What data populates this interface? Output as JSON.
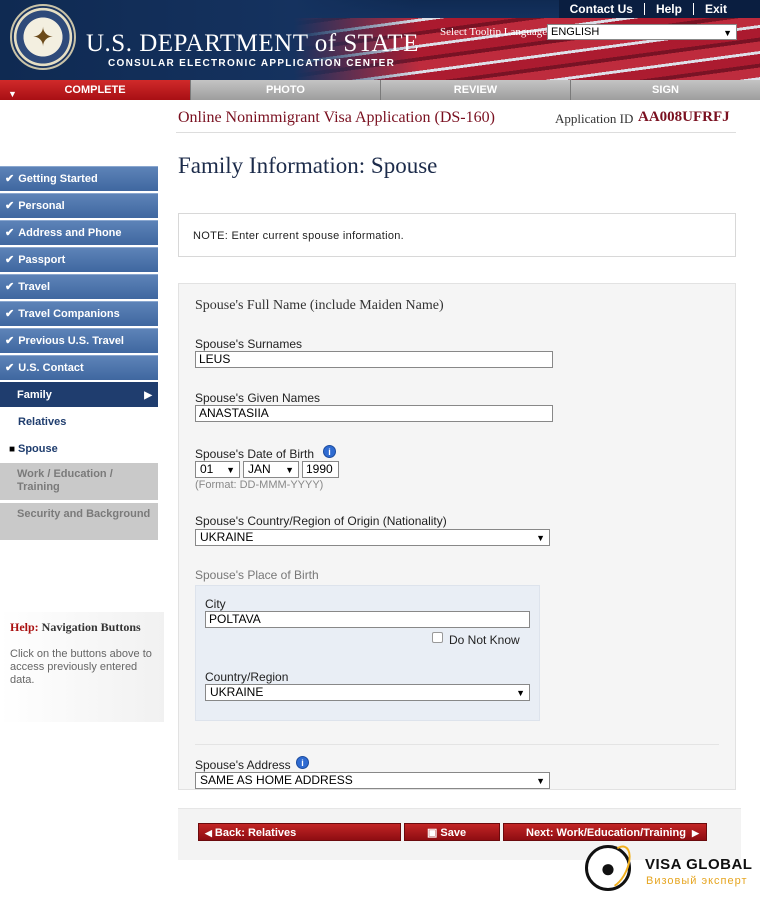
{
  "header": {
    "links": [
      "Contact Us",
      "Help",
      "Exit"
    ],
    "dept_title": "U.S. DEPARTMENT of STATE",
    "dept_subtitle": "CONSULAR ELECTRONIC APPLICATION CENTER",
    "tooltip_label": "Select Tooltip Language",
    "tooltip_value": "ENGLISH"
  },
  "steps": [
    {
      "label": "COMPLETE",
      "active": true
    },
    {
      "label": "PHOTO",
      "active": false
    },
    {
      "label": "REVIEW",
      "active": false
    },
    {
      "label": "SIGN",
      "active": false
    }
  ],
  "app": {
    "title": "Online Nonimmigrant Visa Application (DS-160)",
    "id_label": "Application ID",
    "id_value": "AA008UFRFJ"
  },
  "page_title": "Family Information: Spouse",
  "sidebar": {
    "completed": [
      "Getting Started",
      "Personal",
      "Address and Phone",
      "Passport",
      "Travel",
      "Travel Companions",
      "Previous U.S. Travel",
      "U.S. Contact"
    ],
    "current": "Family",
    "subitems": [
      "Relatives",
      "Spouse"
    ],
    "disabled": [
      "Work / Education / Training",
      "Security and Background"
    ]
  },
  "help": {
    "title_red": "Help:",
    "title_rest": "Navigation Buttons",
    "text": "Click on the buttons above to access previously entered data."
  },
  "note": "NOTE: Enter current spouse information.",
  "form": {
    "section_title": "Spouse's Full Name (include Maiden Name)",
    "surnames_label": "Spouse's Surnames",
    "surnames_value": "LEUS",
    "given_label": "Spouse's Given Names",
    "given_value": "ANASTASIIA",
    "dob_label": "Spouse's Date of Birth",
    "dob_day": "01",
    "dob_month": "JAN",
    "dob_year": "1990",
    "dob_format": "(Format: DD-MMM-YYYY)",
    "nationality_label": "Spouse's Country/Region of Origin (Nationality)",
    "nationality_value": "UKRAINE",
    "pob_label": "Spouse's Place of Birth",
    "city_label": "City",
    "city_value": "POLTAVA",
    "do_not_know": "Do Not Know",
    "country_label": "Country/Region",
    "country_value": "UKRAINE",
    "address_label": "Spouse's Address",
    "address_value": "SAME AS HOME ADDRESS"
  },
  "buttons": {
    "back": "Back: Relatives",
    "save": "Save",
    "next": "Next: Work/Education/Training"
  },
  "watermark": {
    "name": "VISA GLOBAL",
    "tagline": "Визовый эксперт"
  },
  "info_glyph": "i"
}
